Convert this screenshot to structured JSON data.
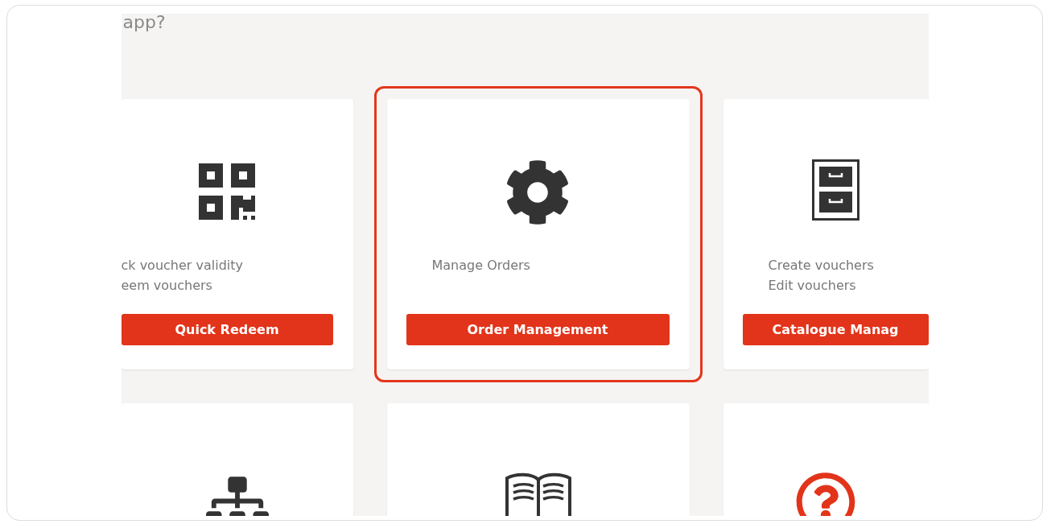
{
  "heading": "app?",
  "cards": [
    {
      "description": [
        "ck voucher validity",
        "eem vouchers"
      ],
      "button": "Quick Redeem",
      "highlighted": false
    },
    {
      "description": [
        "Manage Orders"
      ],
      "button": "Order Management",
      "highlighted": true
    },
    {
      "description": [
        "Create vouchers",
        "Edit vouchers"
      ],
      "button": "Catalogue Manag",
      "highlighted": false
    }
  ]
}
